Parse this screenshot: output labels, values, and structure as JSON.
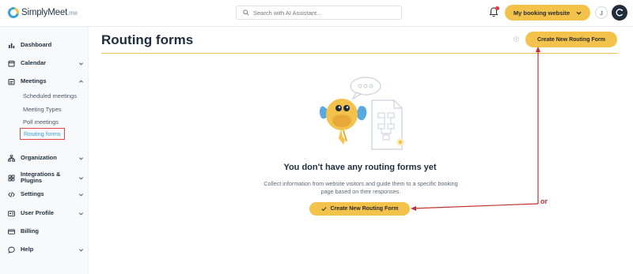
{
  "app": {
    "brand": "SimplyMeet",
    "brand_tld": ".me"
  },
  "topbar": {
    "search_placeholder": "Search with AI Assistant...",
    "site_button": "My booking website",
    "avatar_initial": "J"
  },
  "sidebar": {
    "items": [
      {
        "label": "Dashboard",
        "icon": "chart-icon"
      },
      {
        "label": "Calendar",
        "icon": "calendar-icon"
      },
      {
        "label": "Meetings",
        "icon": "meetings-icon"
      },
      {
        "label": "Organization",
        "icon": "org-icon"
      },
      {
        "label": "Integrations & Plugins",
        "icon": "plug-icon"
      },
      {
        "label": "Settings",
        "icon": "code-icon"
      },
      {
        "label": "User Profile",
        "icon": "id-card-icon"
      },
      {
        "label": "Billing",
        "icon": "card-icon"
      },
      {
        "label": "Help",
        "icon": "chat-icon"
      }
    ],
    "meetings_sub": [
      "Scheduled meetings",
      "Meeting Types",
      "Poll meetings",
      "Routing forms"
    ]
  },
  "main": {
    "title": "Routing forms",
    "create_button": "Create New Routing Form",
    "empty_title": "You don't have any routing forms yet",
    "empty_desc": "Collect information from website visitors and guide them to a specific booking page based on their responses.",
    "create_button_center": "Create New Routing Form"
  },
  "annotation": {
    "or_label": "or",
    "color": "#c0302f"
  },
  "colors": {
    "accent": "#f2c24b",
    "link": "#3aa0d8",
    "text": "#1f2d3d"
  }
}
